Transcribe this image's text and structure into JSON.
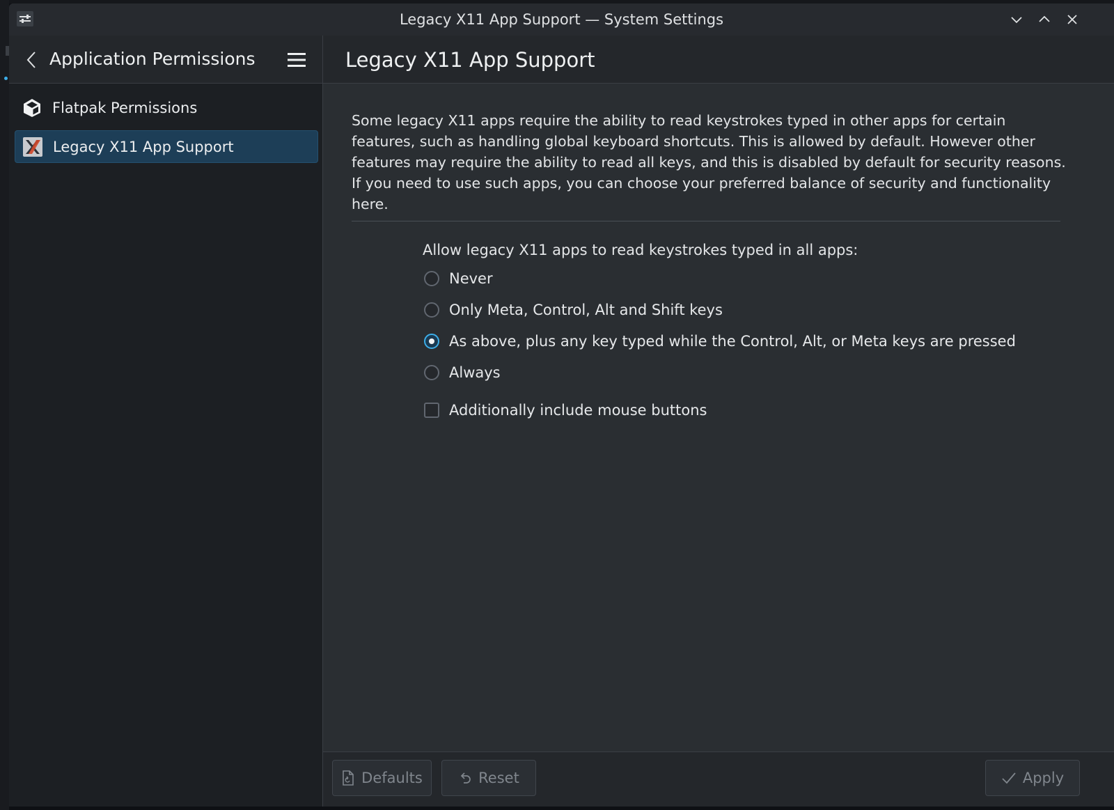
{
  "window": {
    "title": "Legacy X11 App Support — System Settings"
  },
  "sidebar": {
    "header_title": "Application Permissions",
    "items": [
      {
        "label": "Flatpak Permissions",
        "icon": "cube-icon",
        "selected": false
      },
      {
        "label": "Legacy X11 App Support",
        "icon": "x11-icon",
        "selected": true
      }
    ]
  },
  "page": {
    "title": "Legacy X11 App Support",
    "description": "Some legacy X11 apps require the ability to read keystrokes typed in other apps for certain features, such as handling global keyboard shortcuts. This is allowed by default. However other features may require the ability to read all keys, and this is disabled by default for security reasons. If you need to use such apps, you can choose your preferred balance of security and functionality here.",
    "option_label": "Allow legacy X11 apps to read keystrokes typed in all apps:",
    "options": [
      {
        "label": "Never",
        "checked": false
      },
      {
        "label": "Only Meta, Control, Alt and Shift keys",
        "checked": false
      },
      {
        "label": "As above, plus any key typed while the Control, Alt, or Meta keys are pressed",
        "checked": true
      },
      {
        "label": "Always",
        "checked": false
      }
    ],
    "checkbox_label": "Additionally include mouse buttons",
    "checkbox_checked": false
  },
  "footer": {
    "defaults_label": "Defaults",
    "reset_label": "Reset",
    "apply_label": "Apply"
  },
  "colors": {
    "accent": "#3daee9",
    "selection": "#1d3e57",
    "window_bg": "#2a2e32",
    "sidebar_bg": "#1c1f23"
  }
}
